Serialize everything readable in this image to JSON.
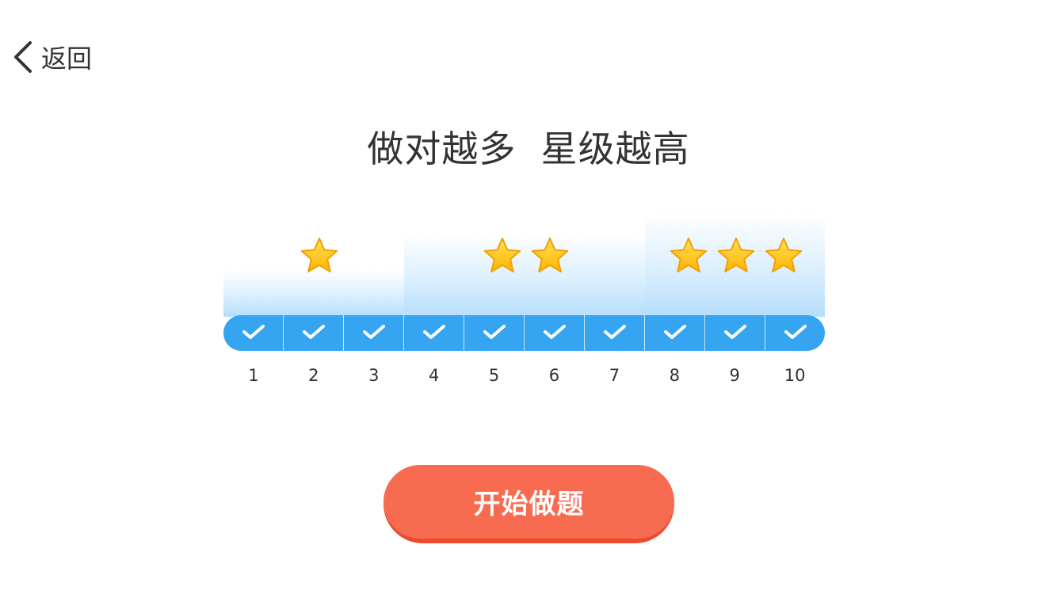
{
  "header": {
    "back_label": "返回",
    "back_icon": "chevron-left-icon"
  },
  "title": "做对越多  星级越高",
  "progress": {
    "tiers": [
      {
        "stars": 1,
        "from": 1,
        "to": 3
      },
      {
        "stars": 2,
        "from": 4,
        "to": 7
      },
      {
        "stars": 3,
        "from": 8,
        "to": 10
      }
    ],
    "cells": [
      "1",
      "2",
      "3",
      "4",
      "5",
      "6",
      "7",
      "8",
      "9",
      "10"
    ],
    "checked_count": 10,
    "cell_icon": "check-icon",
    "star_icon": "star-icon"
  },
  "start_button": {
    "label": "开始做题"
  },
  "colors": {
    "bar": "#35a4f1",
    "button": "#f76b51",
    "button_shadow": "#ee4a2d",
    "star": "#ffc21c",
    "text": "#333333"
  }
}
